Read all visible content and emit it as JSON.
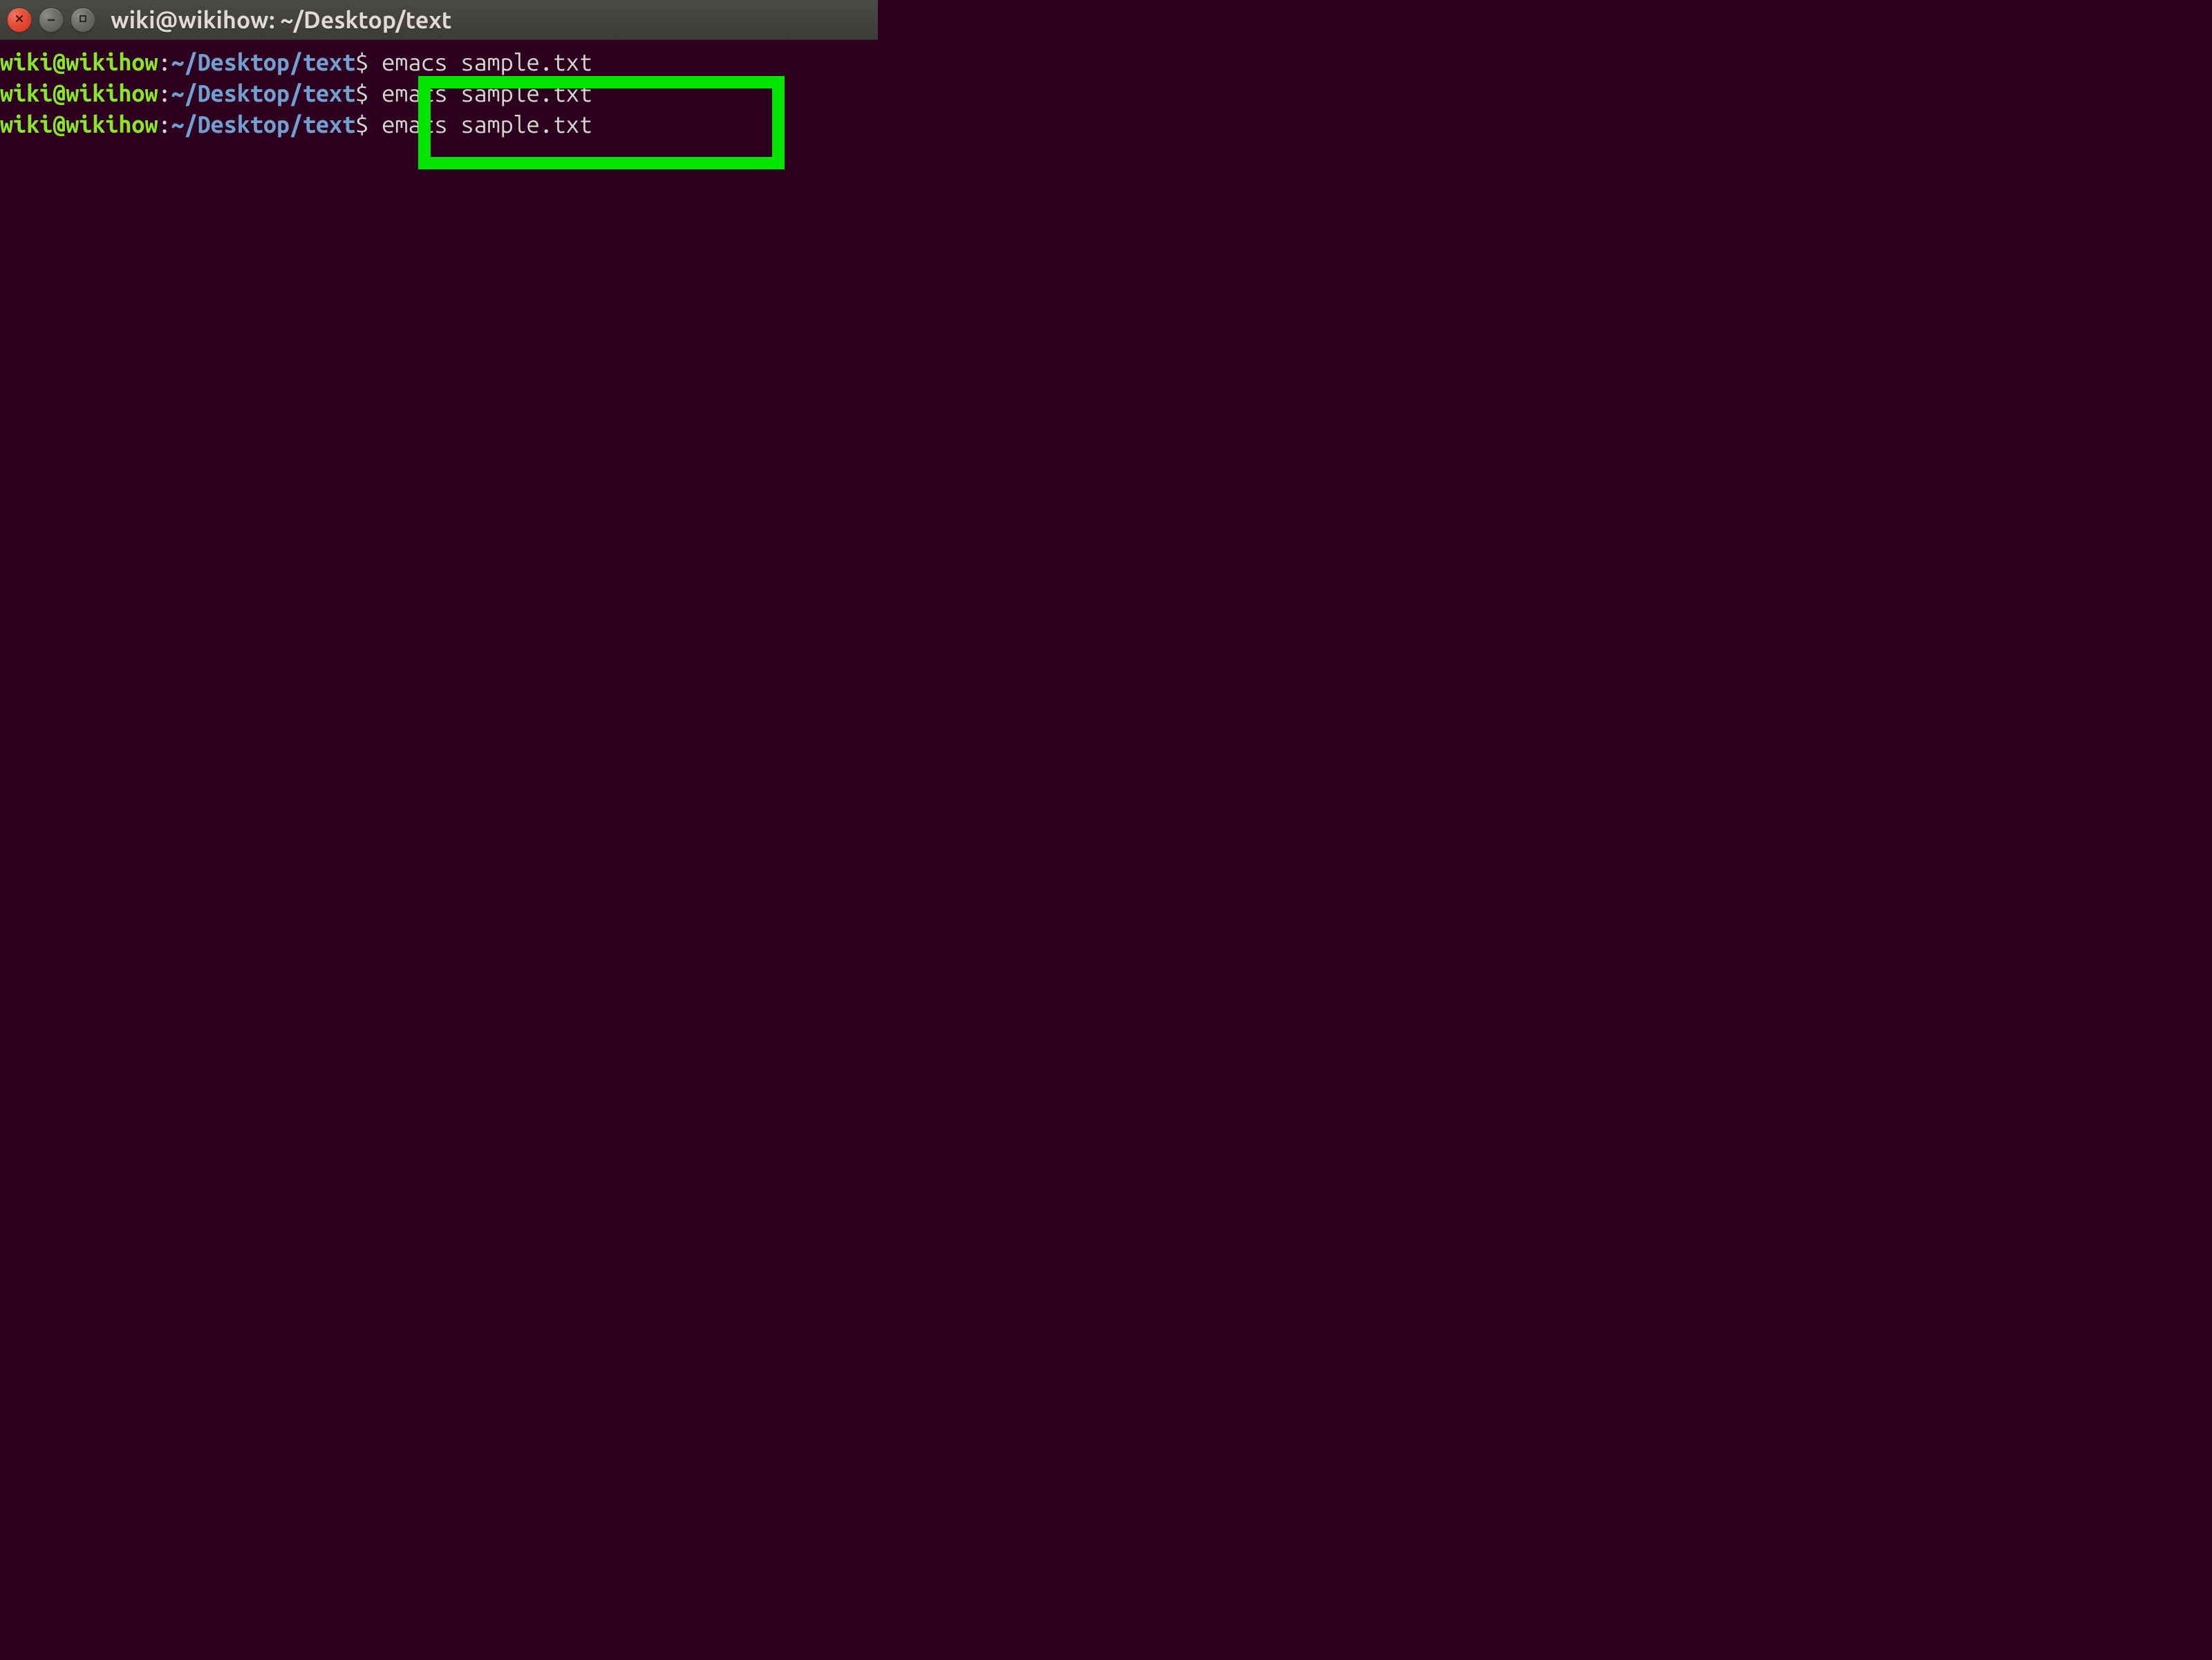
{
  "window": {
    "title": "wiki@wikihow: ~/Desktop/text"
  },
  "prompt": {
    "user": "wiki",
    "at": "@",
    "host": "wikihow",
    "colon": ":",
    "path": "~/Desktop/text",
    "symbol": "$"
  },
  "lines": [
    {
      "command": "emacs sample.txt"
    },
    {
      "command": "emacs sample.txt"
    },
    {
      "command": "emacs sample.txt"
    }
  ],
  "highlight": {
    "color": "#00e400"
  }
}
